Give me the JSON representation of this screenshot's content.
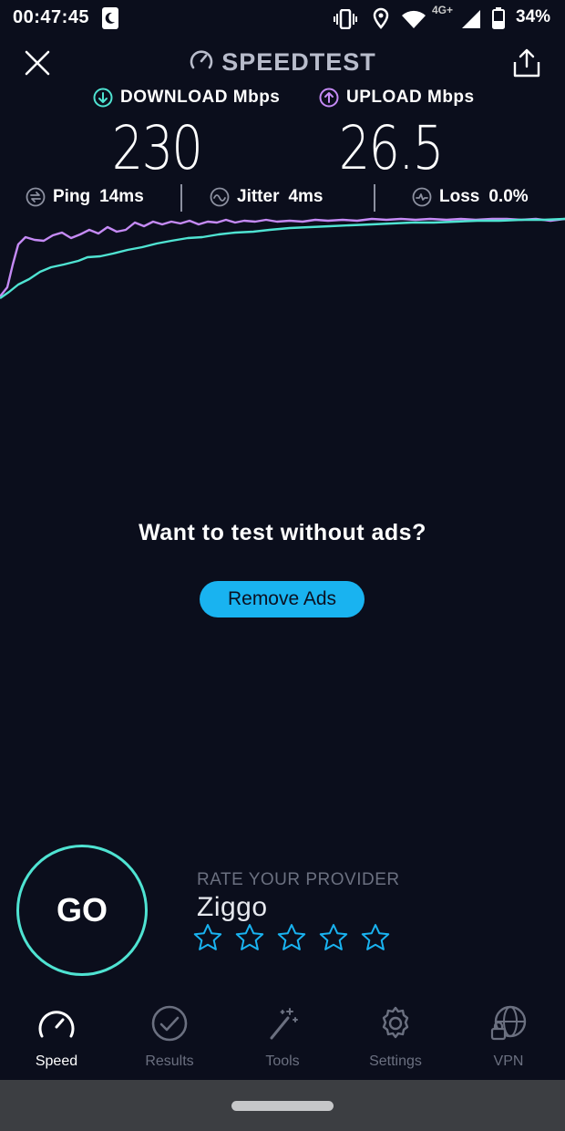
{
  "status_bar": {
    "time": "00:47:45",
    "network": "4G+",
    "battery": "34%"
  },
  "header": {
    "title": "SPEEDTEST"
  },
  "metrics": {
    "download_label": "DOWNLOAD Mbps",
    "download_value": "230",
    "upload_label": "UPLOAD Mbps",
    "upload_value": "26.5"
  },
  "stats": {
    "ping_label": "Ping",
    "ping_value": "14ms",
    "jitter_label": "Jitter",
    "jitter_value": "4ms",
    "loss_label": "Loss",
    "loss_value": "0.0%"
  },
  "promo": {
    "text": "Want to test without ads?",
    "button": "Remove Ads"
  },
  "go": {
    "label": "GO"
  },
  "rating": {
    "label": "RATE YOUR PROVIDER",
    "provider": "Ziggo",
    "stars_filled": 0,
    "stars_total": 5
  },
  "nav": {
    "items": [
      {
        "label": "Speed",
        "icon": "speedometer-icon",
        "active": true
      },
      {
        "label": "Results",
        "icon": "check-circle-icon",
        "active": false
      },
      {
        "label": "Tools",
        "icon": "magic-wand-icon",
        "active": false
      },
      {
        "label": "Settings",
        "icon": "gear-icon",
        "active": false
      },
      {
        "label": "VPN",
        "icon": "globe-lock-icon",
        "active": false
      }
    ]
  },
  "colors": {
    "background": "#0b0e1c",
    "download": "#4fe3d2",
    "upload": "#c58af5",
    "button": "#19b3f0"
  }
}
